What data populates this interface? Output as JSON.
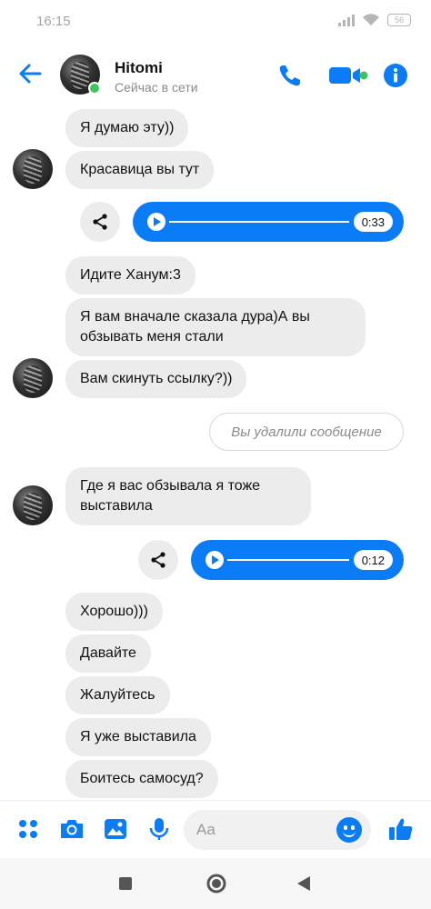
{
  "status_bar": {
    "time": "16:15",
    "battery": "56"
  },
  "header": {
    "name": "Hitomi",
    "status": "Сейчас в сети"
  },
  "messages": [
    {
      "text": "Я думаю эту))"
    },
    {
      "text": "Красавица вы тут"
    },
    {
      "audio_duration": "0:33"
    },
    {
      "text": "Идите Ханум:3"
    },
    {
      "text": "Я вам вначале сказала дура)А вы обзывать меня стали"
    },
    {
      "text": "Вам скинуть ссылку?))"
    },
    {
      "deleted": "Вы удалили сообщение"
    },
    {
      "text": "Где я вас обзывала я тоже выставила"
    },
    {
      "audio_duration": "0:12"
    },
    {
      "text": "Хорошо)))"
    },
    {
      "text": "Давайте"
    },
    {
      "text": "Жалуйтесь"
    },
    {
      "text": "Я уже выставила"
    },
    {
      "text": "Боитесь самосуд?"
    }
  ],
  "composer": {
    "placeholder": "Aa"
  },
  "icons": {
    "back": "arrow-left-icon",
    "call": "phone-icon",
    "video": "video-camera-icon",
    "info": "info-icon",
    "apps": "grid-dots-icon",
    "camera": "camera-icon",
    "gallery": "image-icon",
    "mic": "microphone-icon",
    "emoji": "smiley-icon",
    "like": "thumbs-up-icon",
    "share": "share-icon"
  },
  "colors": {
    "accent": "#0a7cf5",
    "bubble": "#ececec",
    "online": "#3fc35b"
  }
}
